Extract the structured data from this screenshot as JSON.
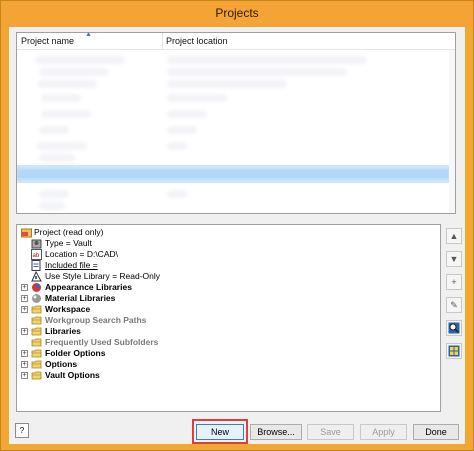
{
  "window": {
    "title": "Projects"
  },
  "list": {
    "columns": [
      "Project name",
      "Project location"
    ]
  },
  "tree": {
    "items": [
      {
        "label": "Project (read only)",
        "icon": "project-icon",
        "expander": false,
        "indent": 0,
        "style": "normal"
      },
      {
        "label": "Type = Vault",
        "icon": "vault-type-icon",
        "expander": false,
        "indent": 1,
        "style": "normal"
      },
      {
        "label": "Location = D:\\CAD\\",
        "icon": "location-icon",
        "expander": false,
        "indent": 1,
        "style": "normal"
      },
      {
        "label": "Included file = ",
        "icon": "included-file-icon",
        "expander": false,
        "indent": 1,
        "style": "underline"
      },
      {
        "label": "Use Style Library = Read-Only",
        "icon": "style-library-icon",
        "expander": false,
        "indent": 1,
        "style": "normal"
      },
      {
        "label": "Appearance Libraries",
        "icon": "appearance-libraries-icon",
        "expander": true,
        "indent": 0,
        "style": "bold"
      },
      {
        "label": "Material Libraries",
        "icon": "material-libraries-icon",
        "expander": true,
        "indent": 0,
        "style": "bold"
      },
      {
        "label": "Workspace",
        "icon": "workspace-icon",
        "expander": true,
        "indent": 0,
        "style": "bold"
      },
      {
        "label": "Workgroup Search Paths",
        "icon": "workgroup-icon",
        "expander": false,
        "indent": 0,
        "style": "grey"
      },
      {
        "label": "Libraries",
        "icon": "libraries-icon",
        "expander": true,
        "indent": 0,
        "style": "bold"
      },
      {
        "label": "Frequently Used Subfolders",
        "icon": "subfolders-icon",
        "expander": false,
        "indent": 0,
        "style": "grey"
      },
      {
        "label": "Folder Options",
        "icon": "folder-options-icon",
        "expander": true,
        "indent": 0,
        "style": "bold"
      },
      {
        "label": "Options",
        "icon": "options-icon",
        "expander": true,
        "indent": 0,
        "style": "bold"
      },
      {
        "label": "Vault Options",
        "icon": "vault-options-icon",
        "expander": true,
        "indent": 0,
        "style": "bold"
      }
    ]
  },
  "side_buttons": [
    {
      "name": "move-up-button",
      "glyph": "▲",
      "enabled": false
    },
    {
      "name": "move-down-button",
      "glyph": "▼",
      "enabled": false
    },
    {
      "name": "add-button",
      "glyph": "+",
      "enabled": false
    },
    {
      "name": "edit-button",
      "glyph": "✎",
      "enabled": false
    },
    {
      "name": "find-button",
      "glyph": "🔍",
      "enabled": true
    },
    {
      "name": "configure-button",
      "glyph": "▦",
      "enabled": true
    }
  ],
  "buttons": {
    "new": "New",
    "browse": "Browse...",
    "save": "Save",
    "apply": "Apply",
    "done": "Done",
    "help": "?"
  }
}
